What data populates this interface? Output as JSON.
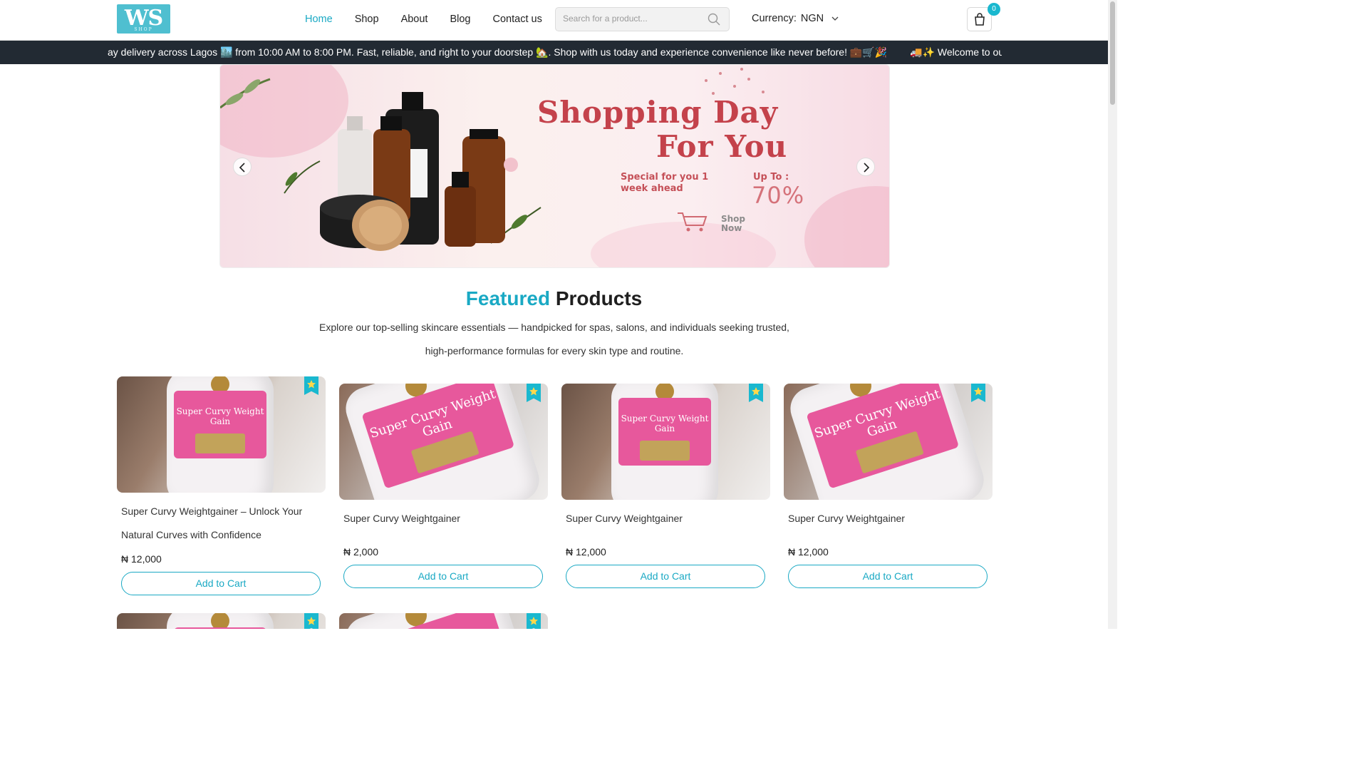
{
  "header": {
    "logo_text": "WS",
    "logo_sub": "SHOP",
    "nav": [
      {
        "label": "Home",
        "active": true
      },
      {
        "label": "Shop",
        "active": false
      },
      {
        "label": "About",
        "active": false
      },
      {
        "label": "Blog",
        "active": false
      },
      {
        "label": "Contact us",
        "active": false
      }
    ],
    "search_placeholder": "Search for a product...",
    "currency_label": "Currency:",
    "currency_value": "NGN",
    "cart_count": "0"
  },
  "marquee": {
    "text_1": "ay delivery across Lagos 🏙️ from 10:00 AM to 8:00 PM. Fast, reliable, and right to your doorstep 🏡. Shop with us today and experience convenience like never before! 💼🛒🎉",
    "text_2": "🚚✨ Welcome to our store! Enjoy sa"
  },
  "hero": {
    "title_line1": "Shopping Day",
    "title_line2": "For You",
    "special": "Special for you 1 week ahead",
    "up_to": "Up To :",
    "percent": "70%",
    "shop_now": "Shop Now"
  },
  "section": {
    "title_highlight": "Featured",
    "title_rest": "Products",
    "description": "Explore our top-selling skincare essentials — handpicked for spas, salons, and individuals seeking trusted, high-performance formulas for every skin type and routine."
  },
  "products": [
    {
      "name": "Super Curvy Weightgainer – Unlock Your Natural Curves with Confidence",
      "price": "₦ 12,000",
      "button": "Add to Cart",
      "label": "Super Curvy Weight Gain"
    },
    {
      "name": "Super Curvy Weightgainer",
      "price": "₦ 2,000",
      "button": "Add to Cart",
      "label": "Super Curvy Weight Gain"
    },
    {
      "name": "Super Curvy Weightgainer",
      "price": "₦ 12,000",
      "button": "Add to Cart",
      "label": "Super Curvy Weight Gain"
    },
    {
      "name": "Super Curvy Weightgainer",
      "price": "₦ 12,000",
      "button": "Add to Cart",
      "label": "Super Curvy Weight Gain"
    }
  ],
  "colors": {
    "accent": "#1aa9c4",
    "marquee_bg": "#222a33",
    "hero_title": "#c4424b"
  }
}
